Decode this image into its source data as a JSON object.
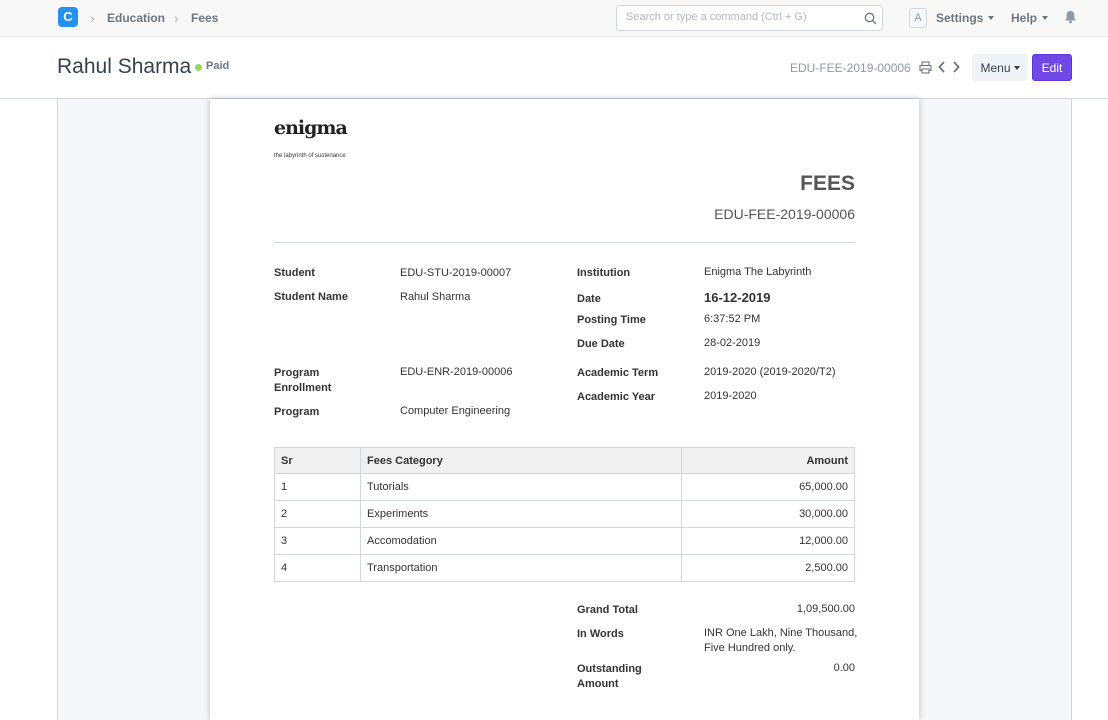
{
  "navbar": {
    "logo_letter": "C",
    "breadcrumbs": [
      "Education",
      "Fees"
    ],
    "search_placeholder": "Search or type a command (Ctrl + G)",
    "avatar_letter": "A",
    "settings_label": "Settings",
    "help_label": "Help"
  },
  "page_head": {
    "title": "Rahul Sharma",
    "status": "Paid",
    "status_color": "#98d85b",
    "doc_id": "EDU-FEE-2019-00006",
    "menu_label": "Menu",
    "edit_label": "Edit",
    "edit_color": "#7048e8"
  },
  "print": {
    "logo_word": "enigma",
    "logo_tagline": "the labyrinth of sustenance",
    "heading": "FEES",
    "subheading": "EDU-FEE-2019-00006",
    "fields": {
      "student_label": "Student",
      "student": "EDU-STU-2019-00007",
      "student_name_label": "Student Name",
      "student_name": "Rahul Sharma",
      "program_enrollment_label_1": "Program",
      "program_enrollment_label_2": "Enrollment",
      "program_enrollment": "EDU-ENR-2019-00006",
      "program_label": "Program",
      "program": "Computer Engineering",
      "institution_label": "Institution",
      "institution": "Enigma The Labyrinth",
      "date_label": "Date",
      "date": "16-12-2019",
      "posting_time_label": "Posting Time",
      "posting_time": "6:37:52 PM",
      "due_date_label": "Due Date",
      "due_date": "28-02-2019",
      "academic_term_label": "Academic Term",
      "academic_term": "2019-2020 (2019-2020/T2)",
      "academic_year_label": "Academic Year",
      "academic_year": "2019-2020"
    },
    "table": {
      "headers": [
        "Sr",
        "Fees Category",
        "Amount"
      ],
      "rows": [
        [
          "1",
          "Tutorials",
          "65,000.00"
        ],
        [
          "2",
          "Experiments",
          "30,000.00"
        ],
        [
          "3",
          "Accomodation",
          "12,000.00"
        ],
        [
          "4",
          "Transportation",
          "2,500.00"
        ]
      ]
    },
    "totals": {
      "grand_total_label": "Grand Total",
      "grand_total": "1,09,500.00",
      "in_words_label": "In Words",
      "in_words_1": "INR One Lakh, Nine Thousand,",
      "in_words_2": "Five Hundred only.",
      "outstanding_label_1": "Outstanding",
      "outstanding_label_2": "Amount",
      "outstanding": "0.00"
    }
  }
}
